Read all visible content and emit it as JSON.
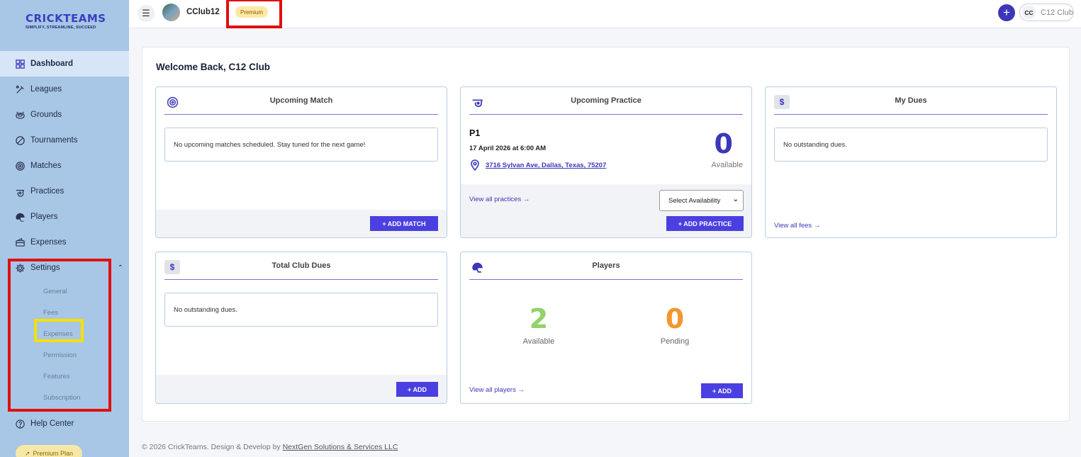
{
  "brand": {
    "name": "CRICKTEAMS",
    "tagline": "SIMPLIFY, STREAMLINE, SUCCEED"
  },
  "sidebar": {
    "items": [
      {
        "label": "Dashboard",
        "icon": "grid-icon",
        "active": true
      },
      {
        "label": "Leagues",
        "icon": "bat-icon"
      },
      {
        "label": "Grounds",
        "icon": "stadium-icon"
      },
      {
        "label": "Tournaments",
        "icon": "ball-icon"
      },
      {
        "label": "Matches",
        "icon": "target-ball-icon"
      },
      {
        "label": "Practices",
        "icon": "whistle-icon"
      },
      {
        "label": "Players",
        "icon": "helmet-icon"
      },
      {
        "label": "Expenses",
        "icon": "wallet-icon"
      },
      {
        "label": "Settings",
        "icon": "gear-icon",
        "expanded": true
      }
    ],
    "settings_sub": [
      "General",
      "Fees",
      "Expenses",
      "Permission",
      "Features",
      "Subscription"
    ],
    "help": "Help Center",
    "premium_plan": "Premium Plan"
  },
  "topbar": {
    "club_name": "CClub12",
    "badge": "Premium",
    "user_initials": "CC",
    "user_name": "C12 Club"
  },
  "main": {
    "welcome": "Welcome Back, C12 Club",
    "upcoming_match": {
      "title": "Upcoming Match",
      "message": "No upcoming matches scheduled. Stay tuned for the next game!",
      "button": "+ ADD MATCH"
    },
    "upcoming_practice": {
      "title": "Upcoming Practice",
      "name": "P1",
      "datetime": "17 April 2026 at 6:00 AM",
      "address": "3716 Sylvan Ave, Dallas, Texas, 75207",
      "available_count": "0",
      "available_label": "Available",
      "view_all": "View all practices",
      "select_label": "Select Availability",
      "button": "+ ADD PRACTICE"
    },
    "my_dues": {
      "title": "My Dues",
      "message": "No outstanding dues.",
      "view_all": "View all fees"
    },
    "total_club_dues": {
      "title": "Total Club Dues",
      "message": "No outstanding dues.",
      "button": "+ ADD"
    },
    "players": {
      "title": "Players",
      "available_count": "2",
      "available_label": "Available",
      "pending_count": "0",
      "pending_label": "Pending",
      "view_all": "View all players",
      "button": "+ ADD"
    }
  },
  "footer": {
    "text": "© 2026 CrickTeams. Design & Develop by",
    "company": "NextGen Solutions & Services LLC"
  },
  "colors": {
    "accent": "#4a3fe0",
    "sidebar": "#a8c6e6",
    "green": "#8fd36a",
    "orange": "#f3962f"
  }
}
